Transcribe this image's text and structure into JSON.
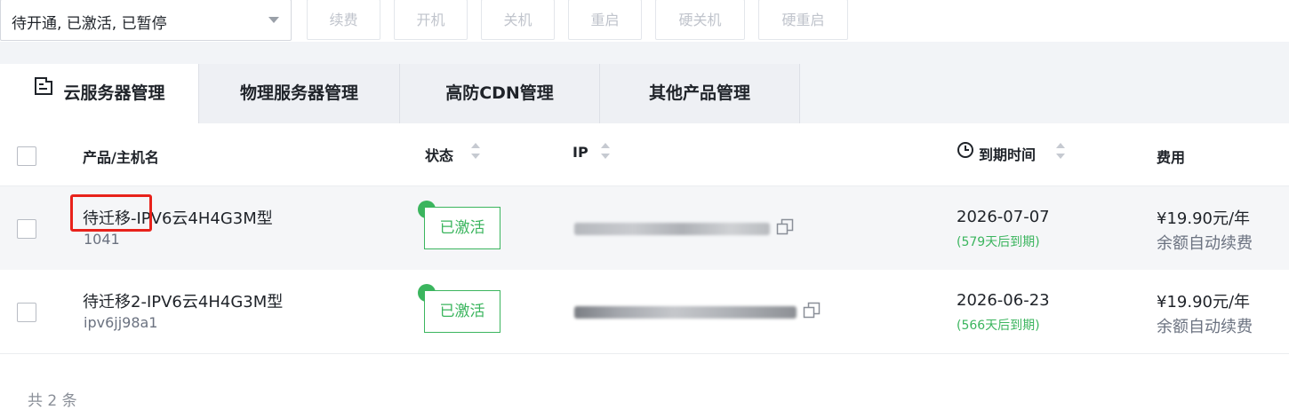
{
  "toolbar": {
    "status_filter": "待开通, 已激活, 已暂停",
    "buttons": [
      "续费",
      "开机",
      "关机",
      "重启",
      "硬关机",
      "硬重启"
    ]
  },
  "tabs": [
    {
      "label": "云服务器管理",
      "active": true
    },
    {
      "label": "物理服务器管理",
      "active": false
    },
    {
      "label": "高防CDN管理",
      "active": false
    },
    {
      "label": "其他产品管理",
      "active": false
    }
  ],
  "table": {
    "headers": {
      "product": "产品/主机名",
      "status": "状态",
      "ip": "IP",
      "expire": "到期时间",
      "fee": "费用"
    },
    "rows": [
      {
        "name": "待迁移-IPV6云4H4G3M型",
        "host": "1041",
        "status": "已激活",
        "expire_date": "2026-07-07",
        "days_left": "(579天后到期)",
        "price": "¥19.90元/年",
        "renew": "余额自动续费"
      },
      {
        "name": "待迁移2-IPV6云4H4G3M型",
        "host": "ipv6jj98a1",
        "status": "已激活",
        "expire_date": "2026-06-23",
        "days_left": "(566天后到期)",
        "price": "¥19.90元/年",
        "renew": "余额自动续费"
      }
    ]
  },
  "footer": {
    "total": "共 2 条"
  },
  "colors": {
    "active_green": "#3bb55e",
    "highlight_red": "#e8221b",
    "tab_bg": "#eef0f4"
  },
  "icons": [
    "chevron-down-icon",
    "server-list-icon",
    "sort-icon",
    "clock-icon",
    "copy-icon"
  ]
}
